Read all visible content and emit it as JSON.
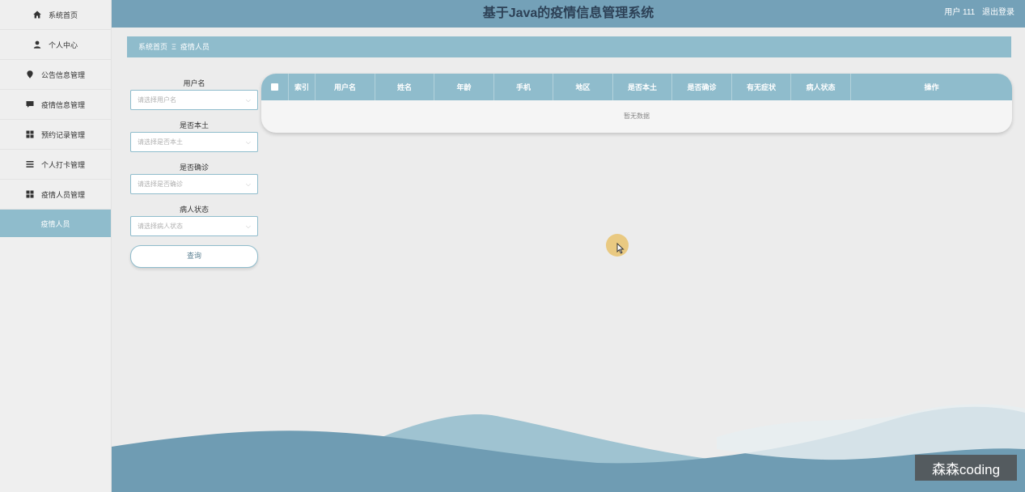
{
  "sidebar": {
    "items": [
      {
        "label": "系统首页",
        "icon": "home-icon"
      },
      {
        "label": "个人中心",
        "icon": "person-icon"
      },
      {
        "label": "公告信息管理",
        "icon": "pin-icon"
      },
      {
        "label": "疫情信息管理",
        "icon": "message-icon"
      },
      {
        "label": "预约记录管理",
        "icon": "grid-icon"
      },
      {
        "label": "个人打卡管理",
        "icon": "list-icon"
      },
      {
        "label": "疫情人员管理",
        "icon": "grid-icon"
      },
      {
        "label": "疫情人员",
        "icon": ""
      }
    ]
  },
  "header": {
    "title": "基于Java的疫情信息管理系统",
    "user_label": "用户 111",
    "logout_label": "退出登录"
  },
  "breadcrumb": {
    "home": "系统首页",
    "separator": "Ξ",
    "current": "疫情人员"
  },
  "filters": {
    "username_label": "用户名",
    "username_placeholder": "请选择用户名",
    "local_label": "是否本土",
    "local_placeholder": "请选择是否本土",
    "confirmed_label": "是否确诊",
    "confirmed_placeholder": "请选择是否确诊",
    "status_label": "病人状态",
    "status_placeholder": "请选择病人状态",
    "search_label": "查询"
  },
  "table": {
    "columns": [
      "索引",
      "用户名",
      "姓名",
      "年龄",
      "手机",
      "地区",
      "是否本土",
      "是否确诊",
      "有无症状",
      "病人状态",
      "操作"
    ],
    "empty_text": "暂无数据"
  },
  "watermark": "森森coding",
  "colors": {
    "header": "#74a1b8",
    "accent": "#8fbccc",
    "title_text": "#2d4156",
    "wave_dark": "#6f9cb3",
    "wave_light": "#9fc3d1"
  }
}
